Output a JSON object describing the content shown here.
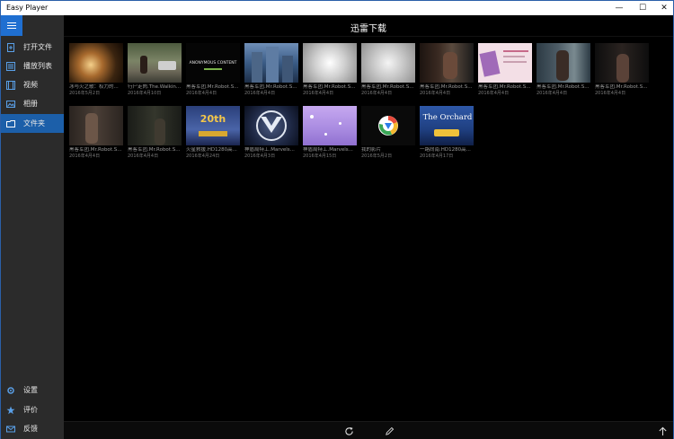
{
  "window": {
    "title": "Easy Player",
    "minimize": "—",
    "maximize": "☐",
    "close": "✕"
  },
  "sidebar": {
    "items": [
      {
        "label": "打开文件",
        "icon": "open-file-icon"
      },
      {
        "label": "播放列表",
        "icon": "playlist-icon"
      },
      {
        "label": "视频",
        "icon": "video-icon"
      },
      {
        "label": "相册",
        "icon": "photo-album-icon"
      },
      {
        "label": "文件夹",
        "icon": "folder-icon",
        "active": true
      }
    ],
    "bottom_items": [
      {
        "label": "设置",
        "icon": "gear-icon"
      },
      {
        "label": "评价",
        "icon": "star-icon"
      },
      {
        "label": "反馈",
        "icon": "mail-icon"
      }
    ]
  },
  "header": {
    "title": "迅雷下载"
  },
  "tiles": [
    {
      "caption": "冰与火之歌：权力的...",
      "date": "2016年5月2日"
    },
    {
      "caption": "行尸走肉.The.Walkin...",
      "date": "2016年4月10日"
    },
    {
      "caption": "黑客军团.Mr.Robot.S...",
      "date": "2016年4月4日"
    },
    {
      "caption": "黑客军团.Mr.Robot.S...",
      "date": "2016年4月4日"
    },
    {
      "caption": "黑客军团.Mr.Robot.S...",
      "date": "2016年4月4日"
    },
    {
      "caption": "黑客军团.Mr.Robot.S...",
      "date": "2016年4月4日"
    },
    {
      "caption": "黑客军团.Mr.Robot.S...",
      "date": "2016年4月4日"
    },
    {
      "caption": "黑客军团.Mr.Robot.S...",
      "date": "2016年4月4日"
    },
    {
      "caption": "黑客军团.Mr.Robot.S...",
      "date": "2016年4月4日"
    },
    {
      "caption": "黑客军团.Mr.Robot.S...",
      "date": "2016年4月4日"
    },
    {
      "caption": "黑客军团.Mr.Robot.S...",
      "date": "2016年4月4日"
    },
    {
      "caption": "黑客军团.Mr.Robot.S...",
      "date": "2016年4月4日"
    },
    {
      "caption": "火星救援.HD1280高...",
      "date": "2016年4月24日"
    },
    {
      "caption": "神盾局特工.Marvels...",
      "date": "2016年4月3日"
    },
    {
      "caption": "神盾局特工.Marvels...",
      "date": "2016年4月15日"
    },
    {
      "caption": "我的影片",
      "date": "2016年5月2日"
    },
    {
      "caption": "一路向南.HD1280高...",
      "date": "2016年4月17日"
    }
  ],
  "thumb_texts": {
    "anonymous": "ANONYMOUS CONTENT",
    "fox": "20th",
    "orchard": "The Orchard"
  },
  "bottombar": {
    "refresh_icon": "refresh-icon",
    "edit_icon": "pencil-icon",
    "up_icon": "arrow-up-icon"
  },
  "colors": {
    "accent": "#1f6fd1",
    "active_item": "#1c5fa9",
    "sidebar_bg": "#2b2b2b"
  }
}
